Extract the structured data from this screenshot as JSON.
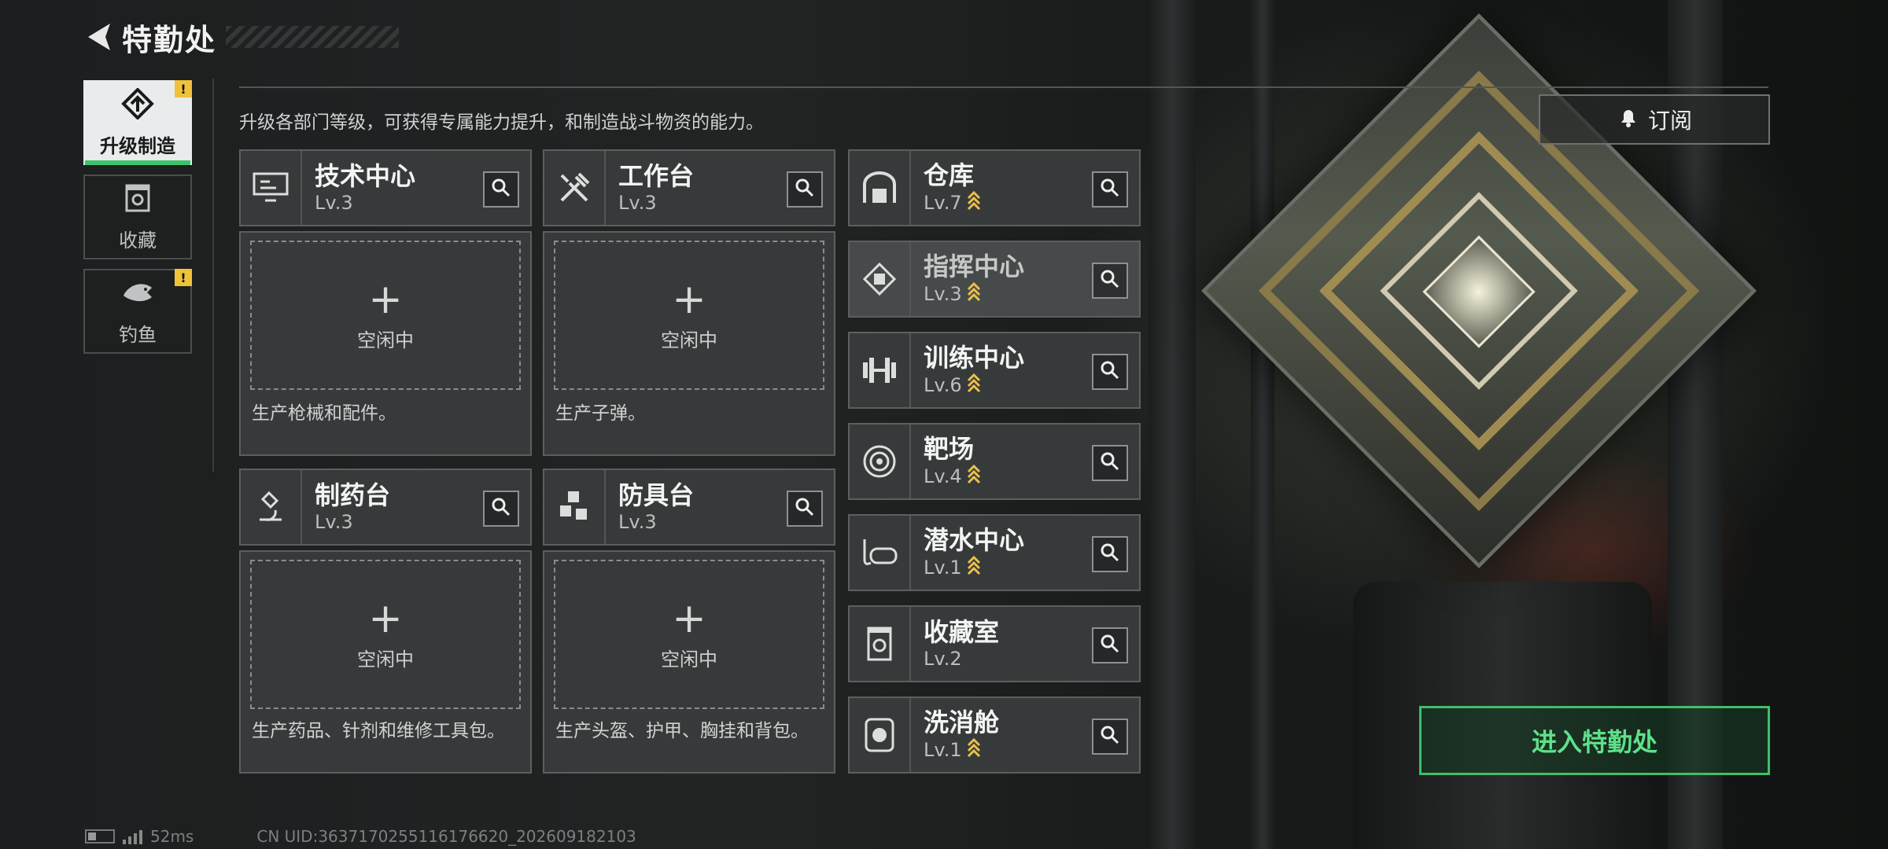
{
  "header": {
    "title": "特勤处"
  },
  "sidenav": [
    {
      "label": "升级制造",
      "icon": "upgrade-icon",
      "active": true,
      "badge": "!"
    },
    {
      "label": "收藏",
      "icon": "collection-icon",
      "active": false,
      "badge": ""
    },
    {
      "label": "钓鱼",
      "icon": "fish-icon",
      "active": false,
      "badge": "!"
    }
  ],
  "description": "升级各部门等级，可获得专属能力提升，和制造战斗物资的能力。",
  "production": [
    {
      "name": "技术中心",
      "level": "Lv.3",
      "status": "空闲中",
      "desc": "生产枪械和配件。",
      "icon": "monitor-icon"
    },
    {
      "name": "工作台",
      "level": "Lv.3",
      "status": "空闲中",
      "desc": "生产子弹。",
      "icon": "tools-icon"
    },
    {
      "name": "制药台",
      "level": "Lv.3",
      "status": "空闲中",
      "desc": "生产药品、针剂和维修工具包。",
      "icon": "microscope-icon"
    },
    {
      "name": "防具台",
      "level": "Lv.3",
      "status": "空闲中",
      "desc": "生产头盔、护甲、胸挂和背包。",
      "icon": "cubes-icon"
    }
  ],
  "facilities": [
    {
      "name": "仓库",
      "level": "Lv.7",
      "upgradable": true,
      "icon": "warehouse-icon"
    },
    {
      "name": "指挥中心",
      "level": "Lv.3",
      "upgradable": true,
      "icon": "chip-icon"
    },
    {
      "name": "训练中心",
      "level": "Lv.6",
      "upgradable": true,
      "icon": "dumbbell-icon"
    },
    {
      "name": "靶场",
      "level": "Lv.4",
      "upgradable": true,
      "icon": "target-icon"
    },
    {
      "name": "潜水中心",
      "level": "Lv.1",
      "upgradable": true,
      "icon": "diving-mask-icon"
    },
    {
      "name": "收藏室",
      "level": "Lv.2",
      "upgradable": false,
      "icon": "display-case-icon"
    },
    {
      "name": "洗消舱",
      "level": "Lv.1",
      "upgradable": true,
      "icon": "decon-pod-icon"
    }
  ],
  "subscribe_label": "订阅",
  "enter_label": "进入特勤处",
  "footer": {
    "ping": "52ms",
    "uid": "CN UID:3637170255116176620_202609182103"
  },
  "colors": {
    "accent_green": "#3fbf6a",
    "upgrade_yellow": "#e9c04a",
    "badge_yellow": "#f0c23a"
  }
}
